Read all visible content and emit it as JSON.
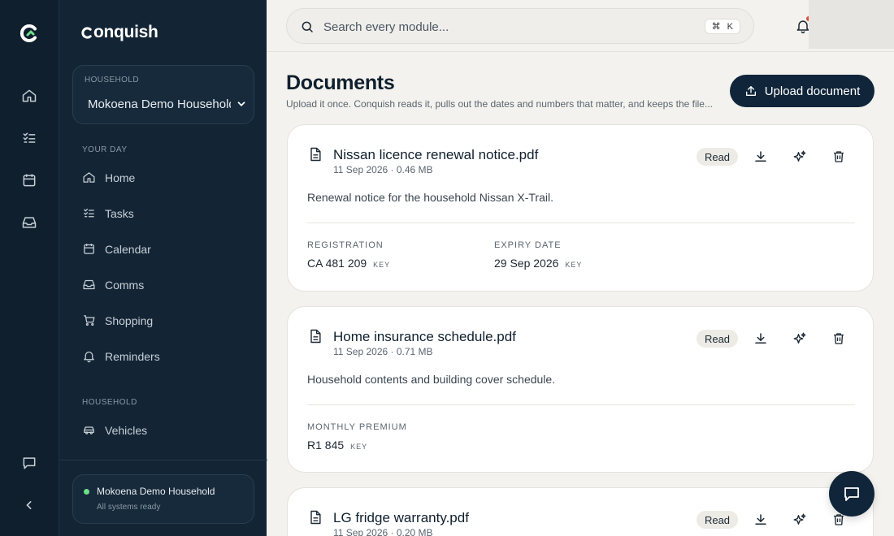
{
  "brand": {
    "name": "onquish"
  },
  "search": {
    "placeholder": "Search every module...",
    "kbd_mod": "⌘",
    "kbd_key": "K"
  },
  "household_select": {
    "caption": "HOUSEHOLD",
    "value": "Mokoena Demo Household"
  },
  "nav": {
    "section_your_day": "YOUR DAY",
    "items_your_day": [
      {
        "label": "Home",
        "icon": "home-icon"
      },
      {
        "label": "Tasks",
        "icon": "tasks-icon"
      },
      {
        "label": "Calendar",
        "icon": "calendar-icon"
      },
      {
        "label": "Comms",
        "icon": "inbox-icon"
      },
      {
        "label": "Shopping",
        "icon": "cart-icon"
      },
      {
        "label": "Reminders",
        "icon": "bell-icon"
      }
    ],
    "section_household": "HOUSEHOLD",
    "items_household": [
      {
        "label": "Vehicles",
        "icon": "car-icon"
      }
    ]
  },
  "status": {
    "name": "Mokoena Demo Household",
    "text": "All systems ready",
    "color": "#6ee087"
  },
  "page": {
    "title": "Documents",
    "subtitle": "Upload it once. Conquish reads it, pulls out the dates and numbers that matter, and keeps the file...",
    "upload_label": "Upload document"
  },
  "documents": [
    {
      "name": "Nissan licence renewal notice.pdf",
      "meta": "11 Sep 2026 · 0.46 MB",
      "status": "Read",
      "description": "Renewal notice for the household Nissan X-Trail.",
      "fields": [
        {
          "label": "REGISTRATION",
          "value": "CA 481 209",
          "tag": "KEY"
        },
        {
          "label": "EXPIRY DATE",
          "value": "29 Sep 2026",
          "tag": "KEY"
        }
      ]
    },
    {
      "name": "Home insurance schedule.pdf",
      "meta": "11 Sep 2026 · 0.71 MB",
      "status": "Read",
      "description": "Household contents and building cover schedule.",
      "fields": [
        {
          "label": "MONTHLY PREMIUM",
          "value": "R1 845",
          "tag": "KEY"
        }
      ]
    },
    {
      "name": "LG fridge warranty.pdf",
      "meta": "11 Sep 2026 · 0.20 MB",
      "status": "Read",
      "description": "",
      "fields": []
    }
  ],
  "colors": {
    "rail": "#0f1f2d",
    "sidebar": "#132535",
    "accent": "#10253a",
    "background": "#f3f2ee",
    "notification_dot": "#e24b3b"
  }
}
